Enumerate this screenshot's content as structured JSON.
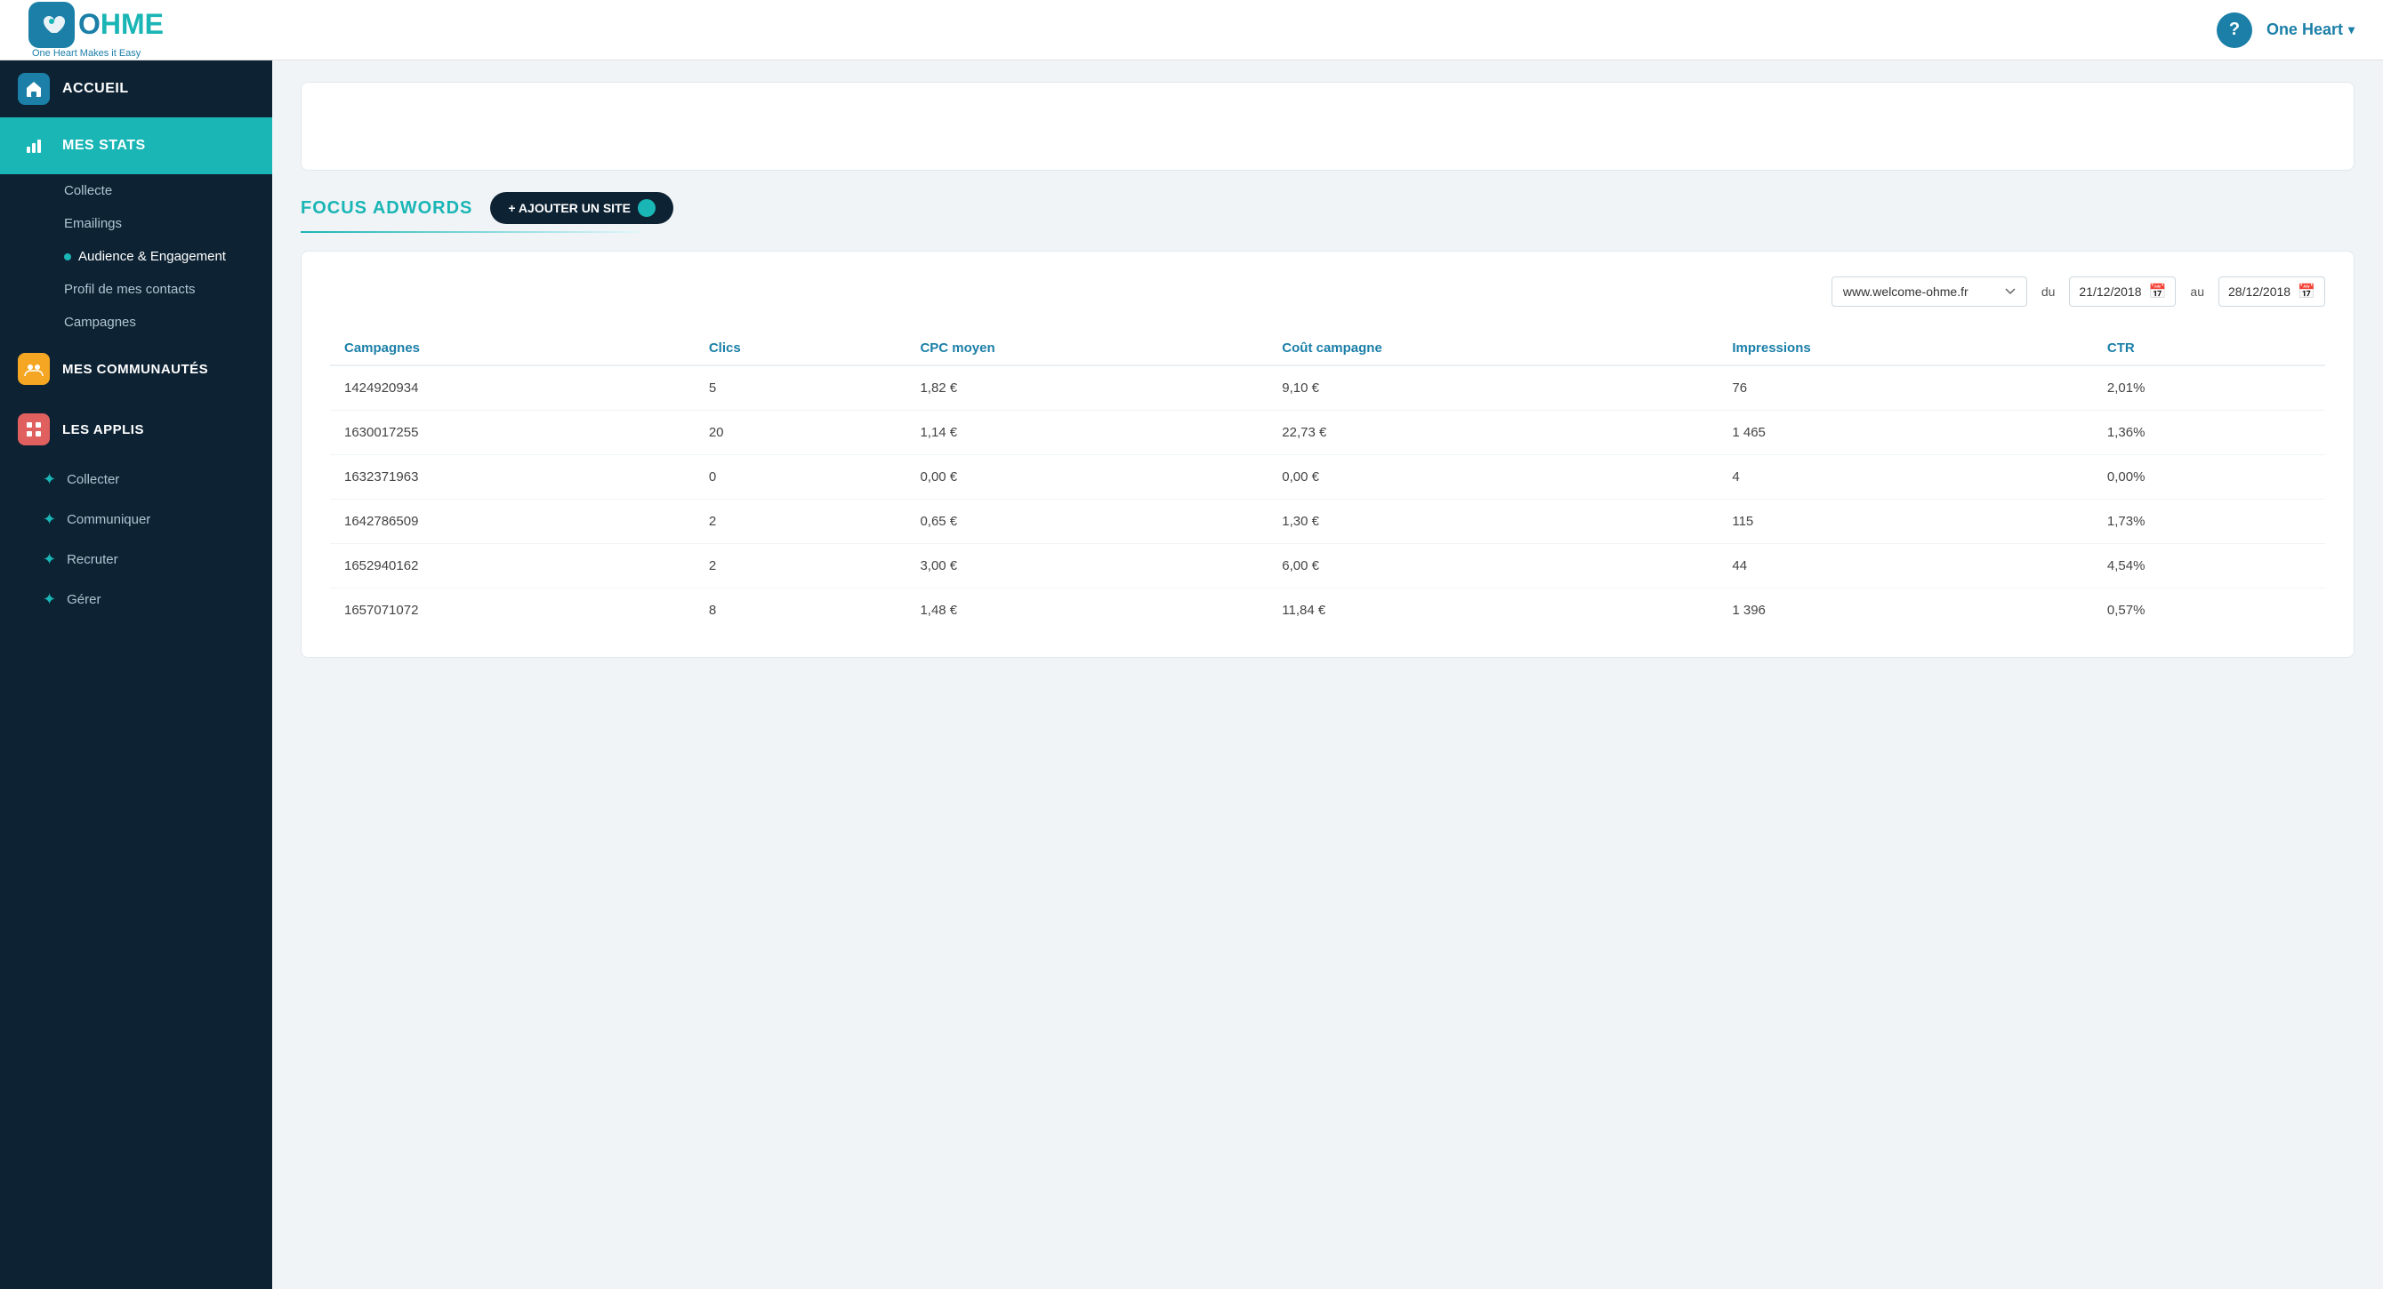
{
  "header": {
    "logo_text": "HME",
    "logo_prefix": "O",
    "logo_subtitle": "One Heart Makes it Easy",
    "help_label": "?",
    "user_name": "One Heart",
    "user_chevron": "▾"
  },
  "sidebar": {
    "items": [
      {
        "id": "accueil",
        "label": "ACCUEIL",
        "icon": "home"
      },
      {
        "id": "mes-stats",
        "label": "MES STATS",
        "icon": "stats",
        "active": true
      }
    ],
    "subitems": [
      {
        "id": "collecte",
        "label": "Collecte"
      },
      {
        "id": "emailings",
        "label": "Emailings"
      },
      {
        "id": "audience",
        "label": "Audience & Engagement",
        "dot": true
      },
      {
        "id": "profil",
        "label": "Profil de mes contacts"
      },
      {
        "id": "campagnes",
        "label": "Campagnes"
      }
    ],
    "communities": {
      "label": "MES COMMUNAUTÉS",
      "icon": "community"
    },
    "applis": {
      "label": "LES APPLIS",
      "icon": "apps",
      "items": [
        {
          "id": "collecter",
          "label": "Collecter"
        },
        {
          "id": "communiquer",
          "label": "Communiquer"
        },
        {
          "id": "recruter",
          "label": "Recruter"
        },
        {
          "id": "gerer",
          "label": "Gérer"
        }
      ]
    }
  },
  "focus": {
    "title": "FOCUS ADWORDS",
    "add_site_label": "+ AJOUTER UN SITE"
  },
  "table": {
    "site_select_value": "www.welcome-ohme.fr",
    "site_options": [
      "www.welcome-ohme.fr"
    ],
    "date_from_label": "du",
    "date_from_value": "21/12/2018",
    "date_to_label": "au",
    "date_to_value": "28/12/2018",
    "columns": [
      {
        "id": "campagnes",
        "label": "Campagnes"
      },
      {
        "id": "clics",
        "label": "Clics"
      },
      {
        "id": "cpc",
        "label": "CPC moyen"
      },
      {
        "id": "cout",
        "label": "Coût campagne"
      },
      {
        "id": "impressions",
        "label": "Impressions"
      },
      {
        "id": "ctr",
        "label": "CTR"
      }
    ],
    "rows": [
      {
        "campagne": "1424920934",
        "clics": "5",
        "cpc": "1,82 €",
        "cout": "9,10 €",
        "impressions": "76",
        "ctr": "2,01%"
      },
      {
        "campagne": "1630017255",
        "clics": "20",
        "cpc": "1,14 €",
        "cout": "22,73 €",
        "impressions": "1 465",
        "ctr": "1,36%"
      },
      {
        "campagne": "1632371963",
        "clics": "0",
        "cpc": "0,00 €",
        "cout": "0,00 €",
        "impressions": "4",
        "ctr": "0,00%"
      },
      {
        "campagne": "1642786509",
        "clics": "2",
        "cpc": "0,65 €",
        "cout": "1,30 €",
        "impressions": "115",
        "ctr": "1,73%"
      },
      {
        "campagne": "1652940162",
        "clics": "2",
        "cpc": "3,00 €",
        "cout": "6,00 €",
        "impressions": "44",
        "ctr": "4,54%"
      },
      {
        "campagne": "1657071072",
        "clics": "8",
        "cpc": "1,48 €",
        "cout": "11,84 €",
        "impressions": "1 396",
        "ctr": "0,57%"
      }
    ]
  }
}
